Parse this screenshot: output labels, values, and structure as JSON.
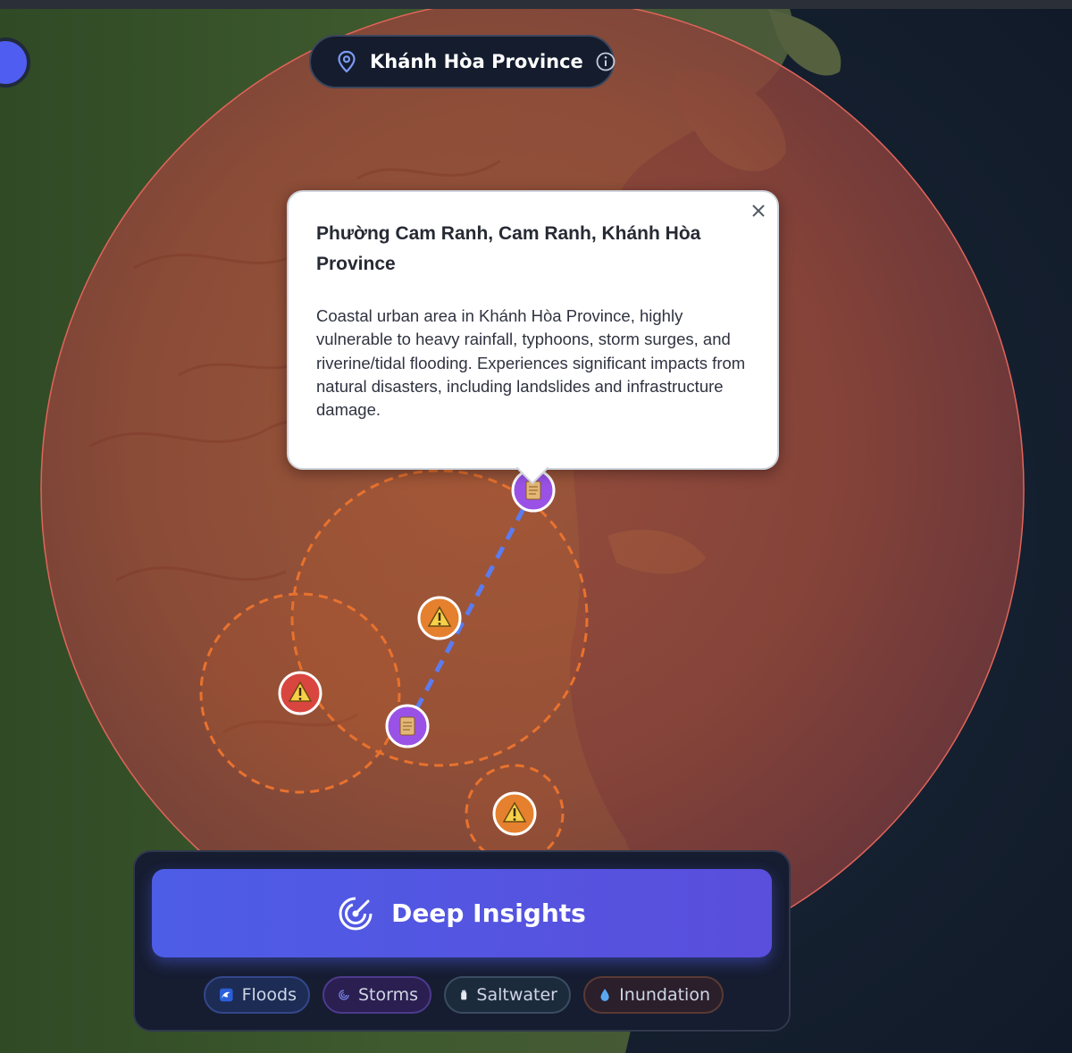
{
  "header": {
    "province_name": "Khánh Hòa Province",
    "location_icon": "map-pin-icon",
    "info_icon": "info-icon"
  },
  "popup": {
    "title": "Phường Cam Ranh, Cam Ranh, Khánh Hòa Province",
    "description": "Coastal urban area in Khánh Hòa Province, highly vulnerable to heavy rainfall, typhoons, storm surges, and riverine/tidal flooding. Experiences significant impacts from natural disasters, including landslides and infrastructure damage.",
    "close_icon": "close-icon"
  },
  "map": {
    "risk_zone_color": "#e0645a",
    "hazard_zone_color": "#e8722e",
    "route_color": "#5b7cf0",
    "markers": [
      {
        "type": "document",
        "icon": "document-icon",
        "color": "#9a52e6"
      },
      {
        "type": "document",
        "icon": "document-icon",
        "color": "#9a52e6"
      },
      {
        "type": "warning",
        "icon": "warning-icon",
        "color": "#e5802f"
      },
      {
        "type": "warning",
        "icon": "warning-icon",
        "color": "#d9463f"
      },
      {
        "type": "warning",
        "icon": "warning-icon",
        "color": "#e5802f"
      }
    ]
  },
  "panel": {
    "deep_insights_label": "Deep Insights",
    "deep_insights_icon": "radar-icon",
    "filters": [
      {
        "label": "Floods",
        "icon": "wave-icon"
      },
      {
        "label": "Storms",
        "icon": "cyclone-icon"
      },
      {
        "label": "Saltwater",
        "icon": "salt-shaker-icon"
      },
      {
        "label": "Inundation",
        "icon": "water-drop-icon"
      }
    ]
  }
}
